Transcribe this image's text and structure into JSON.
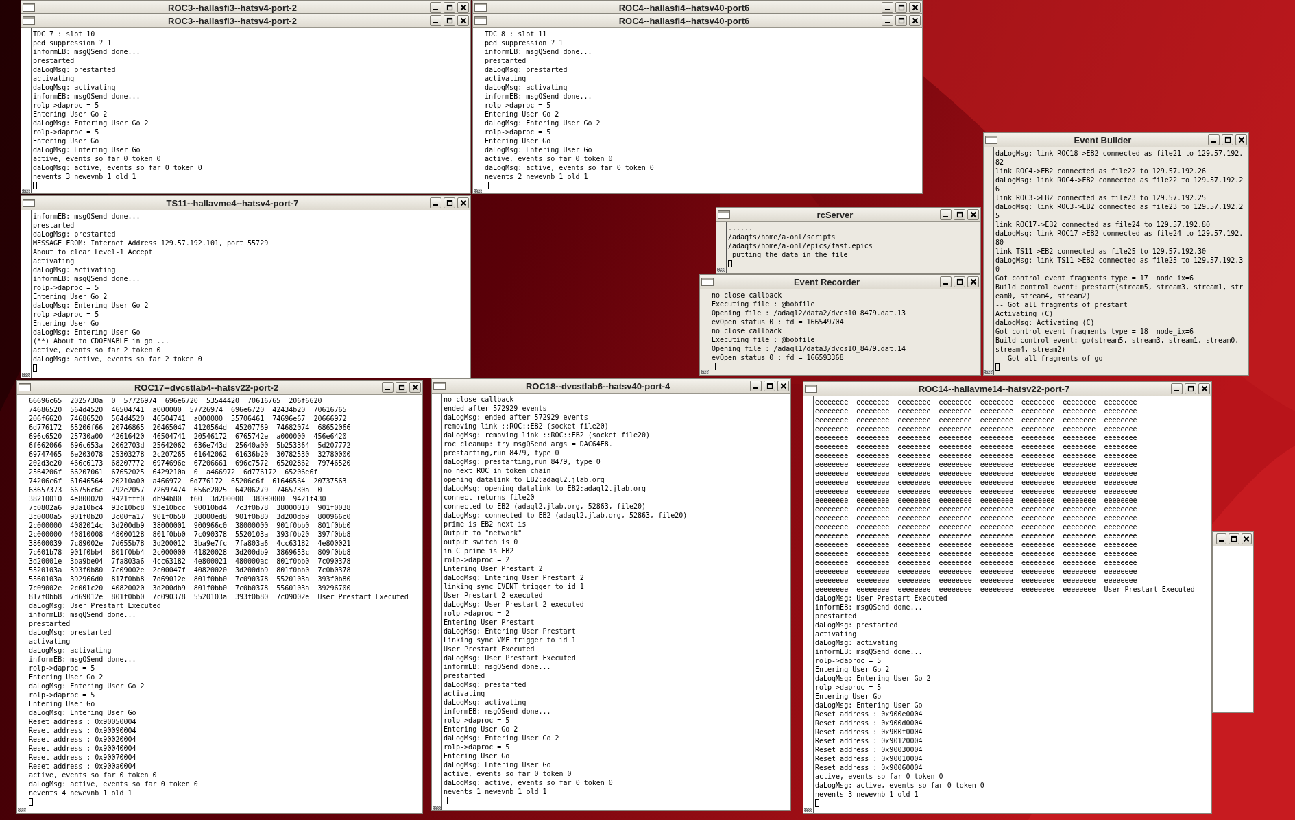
{
  "windows": [
    {
      "kind": "titlebar",
      "title": "ROC3--hallasfi3--hatsv4-port-2"
    },
    {
      "kind": "titlebar",
      "title": "ROC4--hallasfi4--hatsv40-port6"
    },
    {
      "kind": "terminal",
      "title": "ROC3--hallasfi3--hatsv4-port-2",
      "cursor": true,
      "lines": [
        "TDC 7 : slot 10",
        "ped suppression ? 1",
        "informEB: msgQSend done...",
        "prestarted",
        "daLogMsg: prestarted",
        "activating",
        "daLogMsg: activating",
        "informEB: msgQSend done...",
        "rolp->daproc = 5",
        "Entering User Go 2",
        "daLogMsg: Entering User Go 2",
        "rolp->daproc = 5",
        "Entering User Go",
        "daLogMsg: Entering User Go",
        "active, events so far 0 token 0",
        "daLogMsg: active, events so far 0 token 0",
        "nevents 3 newevnb 1 old 1"
      ]
    },
    {
      "kind": "terminal",
      "title": "ROC4--hallasfi4--hatsv40-port6",
      "cursor": true,
      "lines": [
        "TDC 8 : slot 11",
        "ped suppression ? 1",
        "informEB: msgQSend done...",
        "prestarted",
        "daLogMsg: prestarted",
        "activating",
        "daLogMsg: activating",
        "informEB: msgQSend done...",
        "rolp->daproc = 5",
        "Entering User Go 2",
        "daLogMsg: Entering User Go 2",
        "rolp->daproc = 5",
        "Entering User Go",
        "daLogMsg: Entering User Go",
        "active, events so far 0 token 0",
        "daLogMsg: active, events so far 0 token 0",
        "nevents 2 newevnb 1 old 1"
      ]
    },
    {
      "kind": "terminal",
      "title": "TS11--hallavme4--hatsv4-port-7",
      "cursor": true,
      "lines": [
        "informEB: msgQSend done...",
        "prestarted",
        "daLogMsg: prestarted",
        "MESSAGE FROM: Internet Address 129.57.192.101, port 55729",
        "About to clear Level-1 Accept",
        "activating",
        "daLogMsg: activating",
        "informEB: msgQSend done...",
        "rolp->daproc = 5",
        "Entering User Go 2",
        "daLogMsg: Entering User Go 2",
        "rolp->daproc = 5",
        "Entering User Go",
        "daLogMsg: Entering User Go",
        "(**) About to CDOENABLE in go ...",
        "active, events so far 2 token 0",
        "daLogMsg: active, events so far 2 token 0"
      ]
    },
    {
      "kind": "frame"
    },
    {
      "kind": "console",
      "title": "rcServer",
      "cursor": true,
      "lines": [
        "......",
        "/adaqfs/home/a-onl/scripts",
        "/adaqfs/home/a-onl/epics/fast.epics",
        " putting the data in the file"
      ]
    },
    {
      "kind": "console",
      "title": "Event Recorder",
      "cursor": true,
      "lines": [
        "no close callback",
        "Executing file : @bobfile",
        "Opening file : /adaql2/data2/dvcs10_8479.dat.13",
        "evOpen status 0 : fd = 166549704",
        "no close callback",
        "Executing file : @bobfile",
        "Opening file : /adaql1/data3/dvcs10_8479.dat.14",
        "evOpen status 0 : fd = 166593368"
      ]
    },
    {
      "kind": "console",
      "title": "Event Builder",
      "cursor": true,
      "lines": [
        "daLogMsg: link ROC18->EB2 connected as file21 to 129.57.192.",
        "82",
        "link ROC4->EB2 connected as file22 to 129.57.192.26",
        "daLogMsg: link ROC4->EB2 connected as file22 to 129.57.192.2",
        "6",
        "link ROC3->EB2 connected as file23 to 129.57.192.25",
        "daLogMsg: link ROC3->EB2 connected as file23 to 129.57.192.2",
        "5",
        "link ROC17->EB2 connected as file24 to 129.57.192.80",
        "daLogMsg: link ROC17->EB2 connected as file24 to 129.57.192.",
        "80",
        "link TS11->EB2 connected as file25 to 129.57.192.30",
        "daLogMsg: link TS11->EB2 connected as file25 to 129.57.192.3",
        "0",
        "Got control event fragments type = 17  node_ix=6",
        "Build control event: prestart(stream5, stream3, stream1, str",
        "eam0, stream4, stream2)",
        "-- Got all fragments of prestart",
        "Activating (C)",
        "daLogMsg: Activating (C)",
        "Got control event fragments type = 18  node_ix=6",
        "Build control event: go(stream5, stream3, stream1, stream0,",
        "stream4, stream2)",
        "-- Got all fragments of go"
      ]
    },
    {
      "kind": "terminal",
      "title": "ROC17--dvcstlab4--hatsv22-port-2",
      "cursor": true,
      "lines": [
        "66696c65  2025730a  0  57726974  696e6720  53544420  70616765  206f6620",
        "74686520  564d4520  46504741  a000000  57726974  696e6720  42434b20  70616765",
        "206f6620  74686520  564d4520  46504741  a000000  55706461  74696e67  20666972",
        "6d776172  65206f66  20746865  20465047  4120564d  45207769  74682074  68652066",
        "696c6520  25730a00  42616420  46504741  20546172  6765742e  a000000  456e6420",
        "6f662066  696c653a  2062703d  25642062  636e743d  25640a00  5b253364  5d207772",
        "69747465  6e203078  25303278  2c207265  61642062  61636b20  30782530  32780000",
        "202d3e20  466c6173  68207772  6974696e  67206661  696c7572  65202862  79746520",
        "2564206f  66207061  67652025  6429210a  0  a466972  6d776172  65206e6f",
        "74206c6f  61646564  20210a00  a466972  6d776172  65206c6f  61646564  20737563",
        "63657373  66756c6c  792e2057  72697474  656e2025  64206279  7465730a  0",
        "38210010  4e800020  9421fff0  db94b80  f60  3d200000  38090000  9421f430",
        "7c0802a6  93a10bc4  93c10bc8  93e10bcc  90010bd4  7c3f0b78  38000010  901f0038",
        "3c0000a5  901f0b20  3c00fa17  901f0b50  38000ed8  901f0b80  3d200db9  800966c0",
        "2c000000  4082014c  3d200db9  38000001  900966c0  38000000  901f0bb0  801f0bb0",
        "2c000000  40810008  48000128  801f0bb0  7c090378  5520103a  393f0b20  397f0bb8",
        "38600039  7c89002e  7d655b78  3d200012  3ba9e7fc  7fa803a6  4cc63182  4e800021",
        "7c601b78  901f0bb4  801f0bb4  2c000000  41820028  3d200db9  3869653c  809f0bb8",
        "3d20001e  3ba9be04  7fa803a6  4cc63182  4e800021  480000ac  801f0bb0  7c090378",
        "5520103a  393f0b80  7c09002e  2c00047f  40820020  3d200db9  801f0bb0  7c0b0378",
        "5560103a  392966d0  817f0bb8  7d69012e  801f0bb0  7c090378  5520103a  393f0b80",
        "7c09002e  2c001c20  40820020  3d200db9  801f0bb0  7c0b0378  5560103a  39296700",
        "817f0bb8  7d69012e  801f0bb0  7c090378  5520103a  393f0b80  7c09002e  User Prestart Executed",
        "daLogMsg: User Prestart Executed",
        "informEB: msgQSend done...",
        "prestarted",
        "daLogMsg: prestarted",
        "activating",
        "daLogMsg: activating",
        "informEB: msgQSend done...",
        "rolp->daproc = 5",
        "Entering User Go 2",
        "daLogMsg: Entering User Go 2",
        "rolp->daproc = 5",
        "Entering User Go",
        "daLogMsg: Entering User Go",
        "Reset address : 0x90050004",
        "Reset address : 0x90090004",
        "Reset address : 0x90020004",
        "Reset address : 0x90040004",
        "Reset address : 0x90070004",
        "Reset address : 0x900a0004",
        "active, events so far 0 token 0",
        "daLogMsg: active, events so far 0 token 0",
        "nevents 4 newevnb 1 old 1"
      ]
    },
    {
      "kind": "terminal",
      "title": "ROC18--dvcstlab6--hatsv40-port-4",
      "cursor": true,
      "lines": [
        "no close callback",
        "ended after 572929 events",
        "daLogMsg: ended after 572929 events",
        "removing link ::ROC::EB2 (socket file20)",
        "daLogMsg: removing link ::ROC::EB2 (socket file20)",
        "roc_cleanup: try msgQSend args = DAC64E8.",
        "prestarting,run 8479, type 0",
        "daLogMsg: prestarting,run 8479, type 0",
        "no next ROC in token chain",
        "opening datalink to EB2:adaql2.jlab.org",
        "daLogMsg: opening datalink to EB2:adaql2.jlab.org",
        "connect returns file20",
        "connected to EB2 (adaql2.jlab.org, 52863, file20)",
        "daLogMsg: connected to EB2 (adaql2.jlab.org, 52863, file20)",
        "prime is EB2 next is",
        "Output to \"network\"",
        "output switch is 0",
        "in C prime is EB2",
        "rolp->daproc = 2",
        "Entering User Prestart 2",
        "daLogMsg: Entering User Prestart 2",
        "linking sync EVENT trigger to id 1",
        "User Prestart 2 executed",
        "daLogMsg: User Prestart 2 executed",
        "rolp->daproc = 2",
        "Entering User Prestart",
        "daLogMsg: Entering User Prestart",
        "Linking sync VME trigger to id 1",
        "User Prestart Executed",
        "daLogMsg: User Prestart Executed",
        "informEB: msgQSend done...",
        "prestarted",
        "daLogMsg: prestarted",
        "activating",
        "daLogMsg: activating",
        "informEB: msgQSend done...",
        "rolp->daproc = 5",
        "Entering User Go 2",
        "daLogMsg: Entering User Go 2",
        "rolp->daproc = 5",
        "Entering User Go",
        "daLogMsg: Entering User Go",
        "active, events so far 0 token 0",
        "daLogMsg: active, events so far 0 token 0",
        "nevents 1 newevnb 1 old 1"
      ]
    },
    {
      "kind": "terminal",
      "title": "ROC14--hallavme14--hatsv22-port-7",
      "cursor": true,
      "lines": [
        "eeeeeeee  eeeeeeee  eeeeeeee  eeeeeeee  eeeeeeee  eeeeeeee  eeeeeeee  eeeeeeee",
        "eeeeeeee  eeeeeeee  eeeeeeee  eeeeeeee  eeeeeeee  eeeeeeee  eeeeeeee  eeeeeeee",
        "eeeeeeee  eeeeeeee  eeeeeeee  eeeeeeee  eeeeeeee  eeeeeeee  eeeeeeee  eeeeeeee",
        "eeeeeeee  eeeeeeee  eeeeeeee  eeeeeeee  eeeeeeee  eeeeeeee  eeeeeeee  eeeeeeee",
        "eeeeeeee  eeeeeeee  eeeeeeee  eeeeeeee  eeeeeeee  eeeeeeee  eeeeeeee  eeeeeeee",
        "eeeeeeee  eeeeeeee  eeeeeeee  eeeeeeee  eeeeeeee  eeeeeeee  eeeeeeee  eeeeeeee",
        "eeeeeeee  eeeeeeee  eeeeeeee  eeeeeeee  eeeeeeee  eeeeeeee  eeeeeeee  eeeeeeee",
        "eeeeeeee  eeeeeeee  eeeeeeee  eeeeeeee  eeeeeeee  eeeeeeee  eeeeeeee  eeeeeeee",
        "eeeeeeee  eeeeeeee  eeeeeeee  eeeeeeee  eeeeeeee  eeeeeeee  eeeeeeee  eeeeeeee",
        "eeeeeeee  eeeeeeee  eeeeeeee  eeeeeeee  eeeeeeee  eeeeeeee  eeeeeeee  eeeeeeee",
        "eeeeeeee  eeeeeeee  eeeeeeee  eeeeeeee  eeeeeeee  eeeeeeee  eeeeeeee  eeeeeeee",
        "eeeeeeee  eeeeeeee  eeeeeeee  eeeeeeee  eeeeeeee  eeeeeeee  eeeeeeee  eeeeeeee",
        "eeeeeeee  eeeeeeee  eeeeeeee  eeeeeeee  eeeeeeee  eeeeeeee  eeeeeeee  eeeeeeee",
        "eeeeeeee  eeeeeeee  eeeeeeee  eeeeeeee  eeeeeeee  eeeeeeee  eeeeeeee  eeeeeeee",
        "eeeeeeee  eeeeeeee  eeeeeeee  eeeeeeee  eeeeeeee  eeeeeeee  eeeeeeee  eeeeeeee",
        "eeeeeeee  eeeeeeee  eeeeeeee  eeeeeeee  eeeeeeee  eeeeeeee  eeeeeeee  eeeeeeee",
        "eeeeeeee  eeeeeeee  eeeeeeee  eeeeeeee  eeeeeeee  eeeeeeee  eeeeeeee  eeeeeeee",
        "eeeeeeee  eeeeeeee  eeeeeeee  eeeeeeee  eeeeeeee  eeeeeeee  eeeeeeee  eeeeeeee",
        "eeeeeeee  eeeeeeee  eeeeeeee  eeeeeeee  eeeeeeee  eeeeeeee  eeeeeeee  eeeeeeee",
        "eeeeeeee  eeeeeeee  eeeeeeee  eeeeeeee  eeeeeeee  eeeeeeee  eeeeeeee  eeeeeeee",
        "eeeeeeee  eeeeeeee  eeeeeeee  eeeeeeee  eeeeeeee  eeeeeeee  eeeeeeee  eeeeeeee",
        "eeeeeeee  eeeeeeee  eeeeeeee  eeeeeeee  eeeeeeee  eeeeeeee  eeeeeeee  User Prestart Executed",
        "daLogMsg: User Prestart Executed",
        "informEB: msgQSend done...",
        "prestarted",
        "daLogMsg: prestarted",
        "activating",
        "daLogMsg: activating",
        "informEB: msgQSend done...",
        "rolp->daproc = 5",
        "Entering User Go 2",
        "daLogMsg: Entering User Go 2",
        "rolp->daproc = 5",
        "Entering User Go",
        "daLogMsg: Entering User Go",
        "Reset address : 0x900e0004",
        "Reset address : 0x900d0004",
        "Reset address : 0x900f0004",
        "Reset address : 0x90120004",
        "Reset address : 0x90030004",
        "Reset address : 0x90010004",
        "Reset address : 0x90060004",
        "active, events so far 0 token 0",
        "daLogMsg: active, events so far 0 token 0",
        "nevents 3 newevnb 1 old 1"
      ]
    }
  ]
}
